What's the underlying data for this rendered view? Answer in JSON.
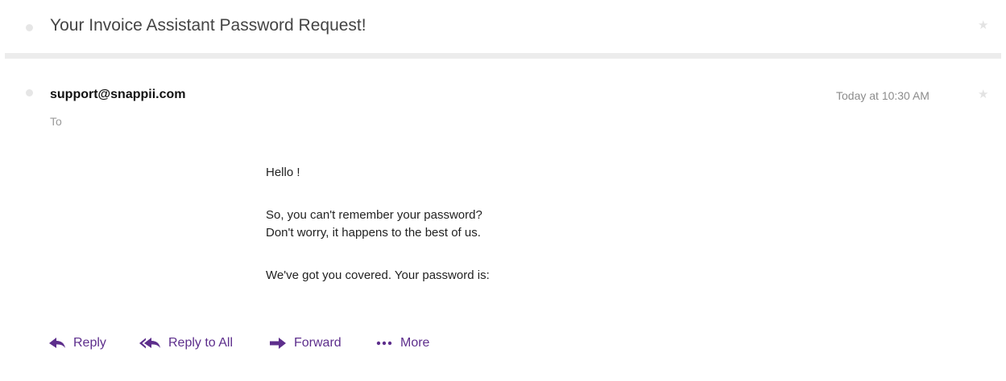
{
  "thread": {
    "subject": "Your Invoice Assistant Password Request!",
    "star_icon": "star-icon"
  },
  "message": {
    "sender": "support@snappii.com",
    "to_label": "To",
    "timestamp": "Today at 10:30 AM",
    "body": {
      "greeting": "Hello !",
      "line1": "So, you can't remember your password?",
      "line2": "Don't worry, it happens to the best of us.",
      "line3": "We've got you covered. Your password is:"
    }
  },
  "actions": {
    "reply": {
      "label": "Reply",
      "icon": "reply-icon"
    },
    "reply_all": {
      "label": "Reply to All",
      "icon": "reply-all-icon"
    },
    "forward": {
      "label": "Forward",
      "icon": "forward-icon"
    },
    "more": {
      "label": "More",
      "icon": "more-icon"
    }
  },
  "colors": {
    "action_accent": "#5d2e8c",
    "divider": "#ececec",
    "muted_text": "#8c8c8c"
  }
}
